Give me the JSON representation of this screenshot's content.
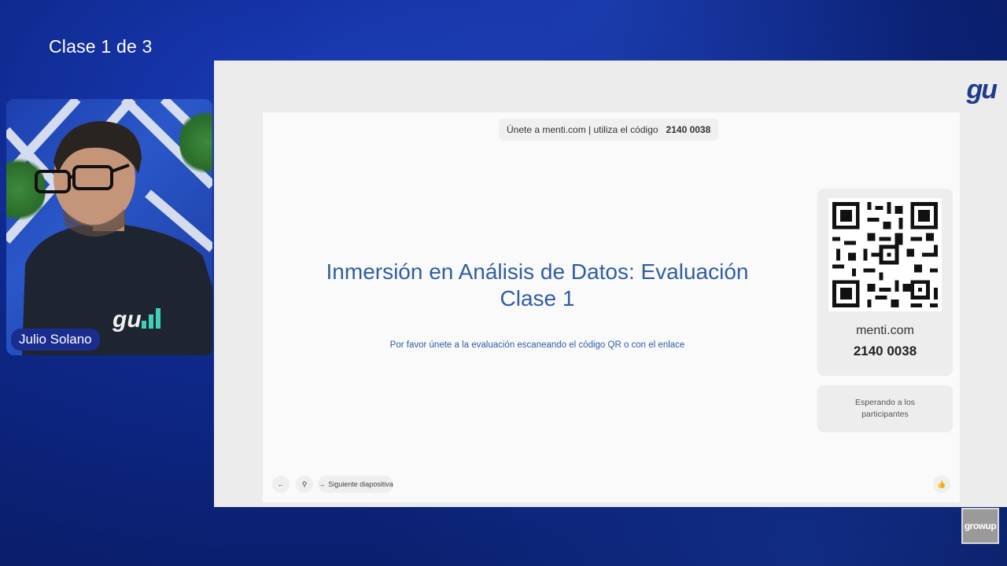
{
  "header": {
    "class_label": "Clase 1 de 3"
  },
  "speaker": {
    "name": "Julio Solano"
  },
  "slide": {
    "join_text": "Únete a menti.com | utiliza el código",
    "join_code": "2140 0038",
    "title_line1": "Inmersión en Análisis de Datos: Evaluación",
    "title_line2": "Clase 1",
    "subtitle": "Por favor únete a la evaluación escaneando el código QR o con el enlace",
    "qr_url": "menti.com",
    "qr_code": "2140 0038",
    "waiting": "Esperando a los participantes",
    "next_slide": "Siguiente diapositiva"
  },
  "logos": {
    "top_right": "gu",
    "bottom_right": "growup"
  },
  "colors": {
    "accent": "#2f5da8",
    "brand": "#1f3b8c",
    "background": "#0f2a8f"
  }
}
